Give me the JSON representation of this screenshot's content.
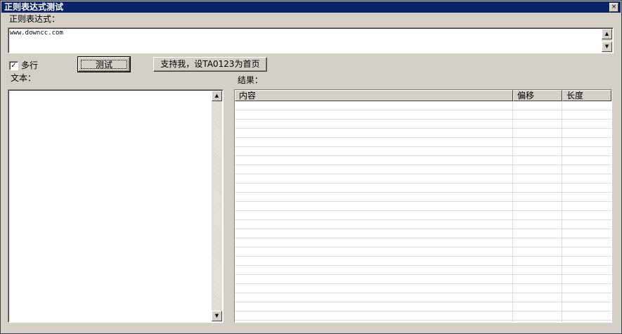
{
  "window": {
    "title": "正则表达式测试",
    "close_glyph": "×"
  },
  "regex": {
    "label": "正则表达式：",
    "value": "www.downcc.com"
  },
  "options": {
    "multiline_label": "多行",
    "multiline_checked": true,
    "check_glyph": "✓"
  },
  "buttons": {
    "test_label": "测试",
    "support_label": "支持我，设TA0123为首页"
  },
  "text_panel": {
    "label": "文本："
  },
  "results": {
    "label": "结果：",
    "columns": [
      "内容",
      "偏移",
      "长度"
    ]
  },
  "scroll_glyphs": {
    "up": "▲",
    "down": "▼"
  }
}
